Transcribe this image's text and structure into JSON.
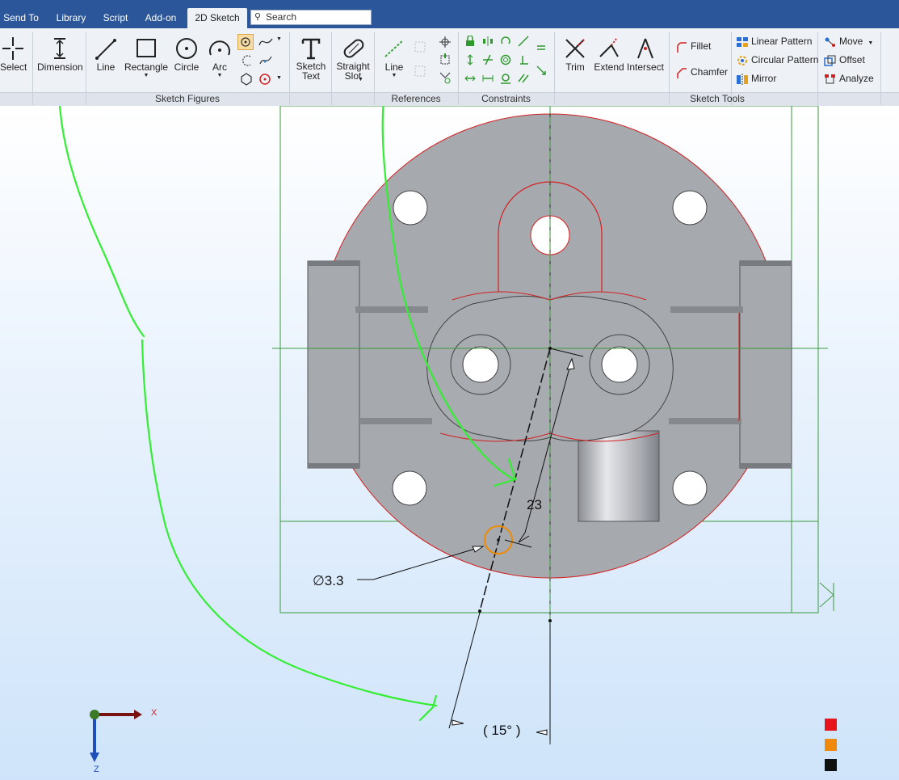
{
  "menu_tabs": [
    {
      "label": "Send To"
    },
    {
      "label": "Library"
    },
    {
      "label": "Script"
    },
    {
      "label": "Add-on"
    },
    {
      "label": "2D Sketch"
    }
  ],
  "search": {
    "placeholder": "Search"
  },
  "ribbon": {
    "select_label": "Select",
    "dimension_label": "Dimension",
    "line_label": "Line",
    "rectangle_label": "Rectangle",
    "circle_label": "Circle",
    "arc_label": "Arc",
    "sketch_text_label": "Sketch\nText",
    "straight_slot_label": "Straight\nSlot",
    "ref_line_label": "Line",
    "trim_label": "Trim",
    "extend_label": "Extend",
    "intersect_label": "Intersect",
    "fillet_label": "Fillet",
    "chamfer_label": "Chamfer",
    "linear_pattern_label": "Linear Pattern",
    "circular_pattern_label": "Circular Pattern",
    "mirror_label": "Mirror",
    "move_label": "Move",
    "offset_label": "Offset",
    "analyze_label": "Analyze",
    "groups": {
      "sketch_figures": "Sketch Figures",
      "references": "References",
      "constraints": "Constraints",
      "sketch_tools": "Sketch Tools"
    }
  },
  "canvas": {
    "dim_diameter": "∅3.3",
    "dim_length": "23",
    "dim_angle": "( 15° )",
    "axis_x": "X",
    "axis_z": "Z",
    "colors": {
      "annotation_green": "#33ee33",
      "sketch_red": "#d42020",
      "selection_orange": "#f08a00",
      "part_gray": "#a6a9ae",
      "guide_green": "#3a9a3a"
    }
  },
  "legend_swatches": [
    "#e8141b",
    "#ef8a0e",
    "#111111"
  ]
}
